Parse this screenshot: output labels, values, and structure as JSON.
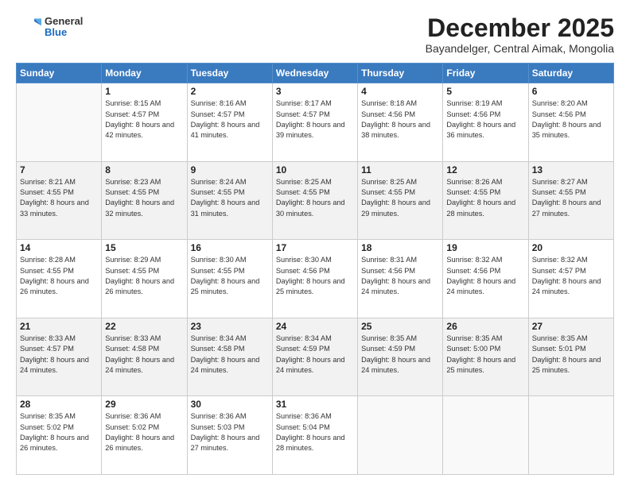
{
  "header": {
    "logo": {
      "general": "General",
      "blue": "Blue"
    },
    "title": "December 2025",
    "location": "Bayandelger, Central Aimak, Mongolia"
  },
  "weekdays": [
    "Sunday",
    "Monday",
    "Tuesday",
    "Wednesday",
    "Thursday",
    "Friday",
    "Saturday"
  ],
  "weeks": [
    [
      {
        "day": null
      },
      {
        "day": 1,
        "sunrise": "8:15 AM",
        "sunset": "4:57 PM",
        "daylight": "8 hours and 42 minutes."
      },
      {
        "day": 2,
        "sunrise": "8:16 AM",
        "sunset": "4:57 PM",
        "daylight": "8 hours and 41 minutes."
      },
      {
        "day": 3,
        "sunrise": "8:17 AM",
        "sunset": "4:57 PM",
        "daylight": "8 hours and 39 minutes."
      },
      {
        "day": 4,
        "sunrise": "8:18 AM",
        "sunset": "4:56 PM",
        "daylight": "8 hours and 38 minutes."
      },
      {
        "day": 5,
        "sunrise": "8:19 AM",
        "sunset": "4:56 PM",
        "daylight": "8 hours and 36 minutes."
      },
      {
        "day": 6,
        "sunrise": "8:20 AM",
        "sunset": "4:56 PM",
        "daylight": "8 hours and 35 minutes."
      }
    ],
    [
      {
        "day": 7,
        "sunrise": "8:21 AM",
        "sunset": "4:55 PM",
        "daylight": "8 hours and 33 minutes."
      },
      {
        "day": 8,
        "sunrise": "8:23 AM",
        "sunset": "4:55 PM",
        "daylight": "8 hours and 32 minutes."
      },
      {
        "day": 9,
        "sunrise": "8:24 AM",
        "sunset": "4:55 PM",
        "daylight": "8 hours and 31 minutes."
      },
      {
        "day": 10,
        "sunrise": "8:25 AM",
        "sunset": "4:55 PM",
        "daylight": "8 hours and 30 minutes."
      },
      {
        "day": 11,
        "sunrise": "8:25 AM",
        "sunset": "4:55 PM",
        "daylight": "8 hours and 29 minutes."
      },
      {
        "day": 12,
        "sunrise": "8:26 AM",
        "sunset": "4:55 PM",
        "daylight": "8 hours and 28 minutes."
      },
      {
        "day": 13,
        "sunrise": "8:27 AM",
        "sunset": "4:55 PM",
        "daylight": "8 hours and 27 minutes."
      }
    ],
    [
      {
        "day": 14,
        "sunrise": "8:28 AM",
        "sunset": "4:55 PM",
        "daylight": "8 hours and 26 minutes."
      },
      {
        "day": 15,
        "sunrise": "8:29 AM",
        "sunset": "4:55 PM",
        "daylight": "8 hours and 26 minutes."
      },
      {
        "day": 16,
        "sunrise": "8:30 AM",
        "sunset": "4:55 PM",
        "daylight": "8 hours and 25 minutes."
      },
      {
        "day": 17,
        "sunrise": "8:30 AM",
        "sunset": "4:56 PM",
        "daylight": "8 hours and 25 minutes."
      },
      {
        "day": 18,
        "sunrise": "8:31 AM",
        "sunset": "4:56 PM",
        "daylight": "8 hours and 24 minutes."
      },
      {
        "day": 19,
        "sunrise": "8:32 AM",
        "sunset": "4:56 PM",
        "daylight": "8 hours and 24 minutes."
      },
      {
        "day": 20,
        "sunrise": "8:32 AM",
        "sunset": "4:57 PM",
        "daylight": "8 hours and 24 minutes."
      }
    ],
    [
      {
        "day": 21,
        "sunrise": "8:33 AM",
        "sunset": "4:57 PM",
        "daylight": "8 hours and 24 minutes."
      },
      {
        "day": 22,
        "sunrise": "8:33 AM",
        "sunset": "4:58 PM",
        "daylight": "8 hours and 24 minutes."
      },
      {
        "day": 23,
        "sunrise": "8:34 AM",
        "sunset": "4:58 PM",
        "daylight": "8 hours and 24 minutes."
      },
      {
        "day": 24,
        "sunrise": "8:34 AM",
        "sunset": "4:59 PM",
        "daylight": "8 hours and 24 minutes."
      },
      {
        "day": 25,
        "sunrise": "8:35 AM",
        "sunset": "4:59 PM",
        "daylight": "8 hours and 24 minutes."
      },
      {
        "day": 26,
        "sunrise": "8:35 AM",
        "sunset": "5:00 PM",
        "daylight": "8 hours and 25 minutes."
      },
      {
        "day": 27,
        "sunrise": "8:35 AM",
        "sunset": "5:01 PM",
        "daylight": "8 hours and 25 minutes."
      }
    ],
    [
      {
        "day": 28,
        "sunrise": "8:35 AM",
        "sunset": "5:02 PM",
        "daylight": "8 hours and 26 minutes."
      },
      {
        "day": 29,
        "sunrise": "8:36 AM",
        "sunset": "5:02 PM",
        "daylight": "8 hours and 26 minutes."
      },
      {
        "day": 30,
        "sunrise": "8:36 AM",
        "sunset": "5:03 PM",
        "daylight": "8 hours and 27 minutes."
      },
      {
        "day": 31,
        "sunrise": "8:36 AM",
        "sunset": "5:04 PM",
        "daylight": "8 hours and 28 minutes."
      },
      {
        "day": null
      },
      {
        "day": null
      },
      {
        "day": null
      }
    ]
  ],
  "labels": {
    "sunrise": "Sunrise:",
    "sunset": "Sunset:",
    "daylight": "Daylight:"
  }
}
